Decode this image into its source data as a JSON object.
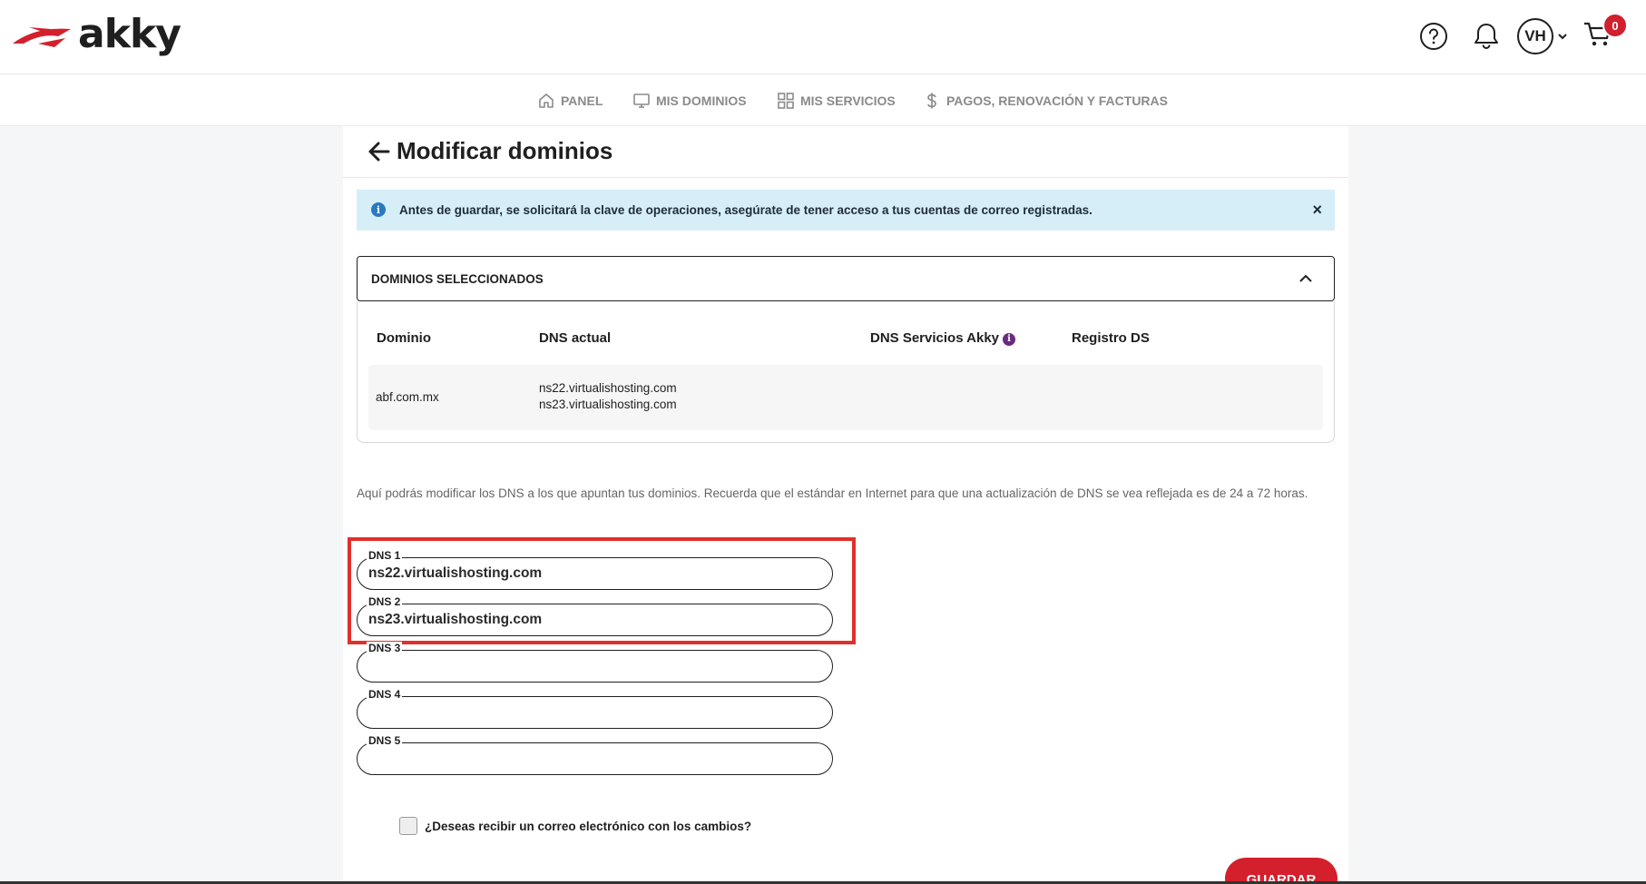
{
  "brand": {
    "logo_text": "akky",
    "accent_color": "#d41f2c"
  },
  "header": {
    "help_icon": "help-circle-icon",
    "bell_icon": "bell-icon",
    "avatar_initials": "VH",
    "cart_count": "0"
  },
  "nav": {
    "items": [
      {
        "label": "PANEL",
        "icon": "home-icon"
      },
      {
        "label": "MIS DOMINIOS",
        "icon": "monitor-icon"
      },
      {
        "label": "MIS SERVICIOS",
        "icon": "grid-icon"
      },
      {
        "label": "PAGOS, RENOVACIÓN Y FACTURAS",
        "icon": "dollar-icon"
      }
    ]
  },
  "page": {
    "title": "Modificar dominios",
    "alert_text": "Antes de guardar, se solicitará la clave de operaciones, asegúrate de tener acceso a tus cuentas de correo registradas.",
    "alert_close": "×",
    "accordion_title": "DOMINIOS SELECCIONADOS",
    "table": {
      "headers": [
        "Dominio",
        "DNS actual",
        "DNS Servicios Akky",
        "Registro DS"
      ],
      "rows": [
        {
          "domain": "abf.com.mx",
          "dns_1": "ns22.virtualishosting.com",
          "dns_2": "ns23.virtualishosting.com"
        }
      ]
    },
    "help_text": "Aquí podrás modificar los DNS a los que apuntan tus dominios. Recuerda que el estándar en Internet para que una actualización de DNS se vea reflejada es de 24 a 72 horas.",
    "dns_fields": [
      {
        "label": "DNS 1",
        "value": "ns22.virtualishosting.com"
      },
      {
        "label": "DNS 2",
        "value": "ns23.virtualishosting.com"
      },
      {
        "label": "DNS 3",
        "value": ""
      },
      {
        "label": "DNS 4",
        "value": ""
      },
      {
        "label": "DNS 5",
        "value": ""
      }
    ],
    "email_checkbox_label": "¿Deseas recibir un correo electrónico con los cambios?",
    "save_label": "GUARDAR"
  }
}
